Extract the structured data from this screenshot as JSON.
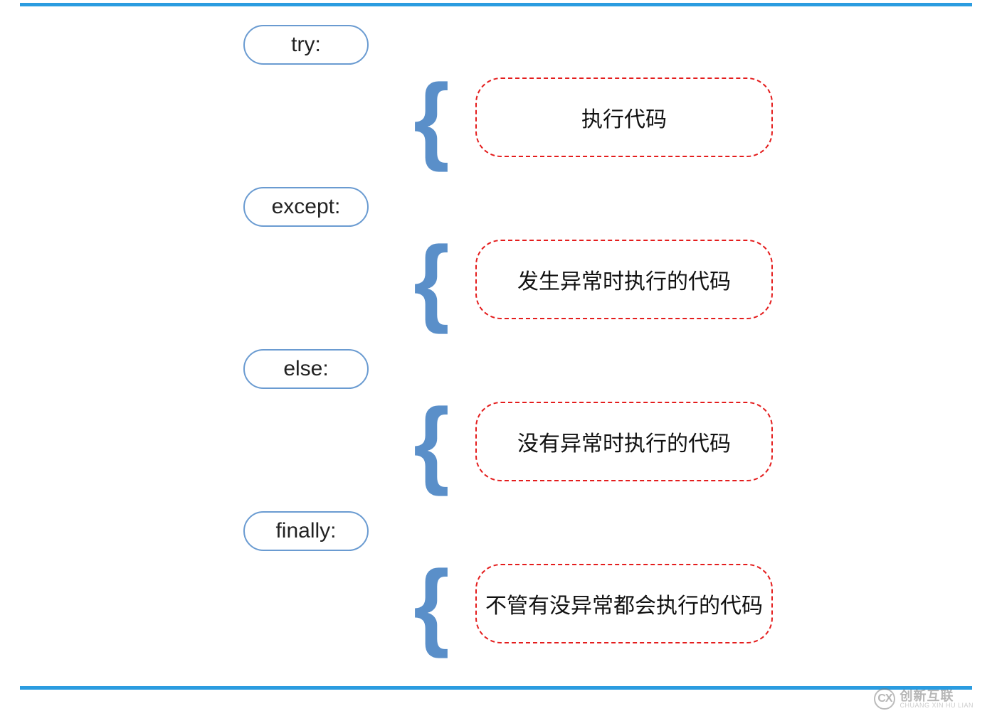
{
  "blocks": [
    {
      "keyword": "try:",
      "description": "执行代码"
    },
    {
      "keyword": "except:",
      "description": "发生异常时执行的代码"
    },
    {
      "keyword": "else:",
      "description": "没有异常时执行的代码"
    },
    {
      "keyword": "finally:",
      "description": "不管有没异常都会执行的代码"
    }
  ],
  "watermark": {
    "logo_text": "CX",
    "main": "创新互联",
    "sub": "CHUANG XIN HU LIAN"
  },
  "colors": {
    "frame": "#2b9ce0",
    "keyword_border": "#6a9bd1",
    "brace": "#5a8fc9",
    "desc_border": "#e41d1d"
  }
}
